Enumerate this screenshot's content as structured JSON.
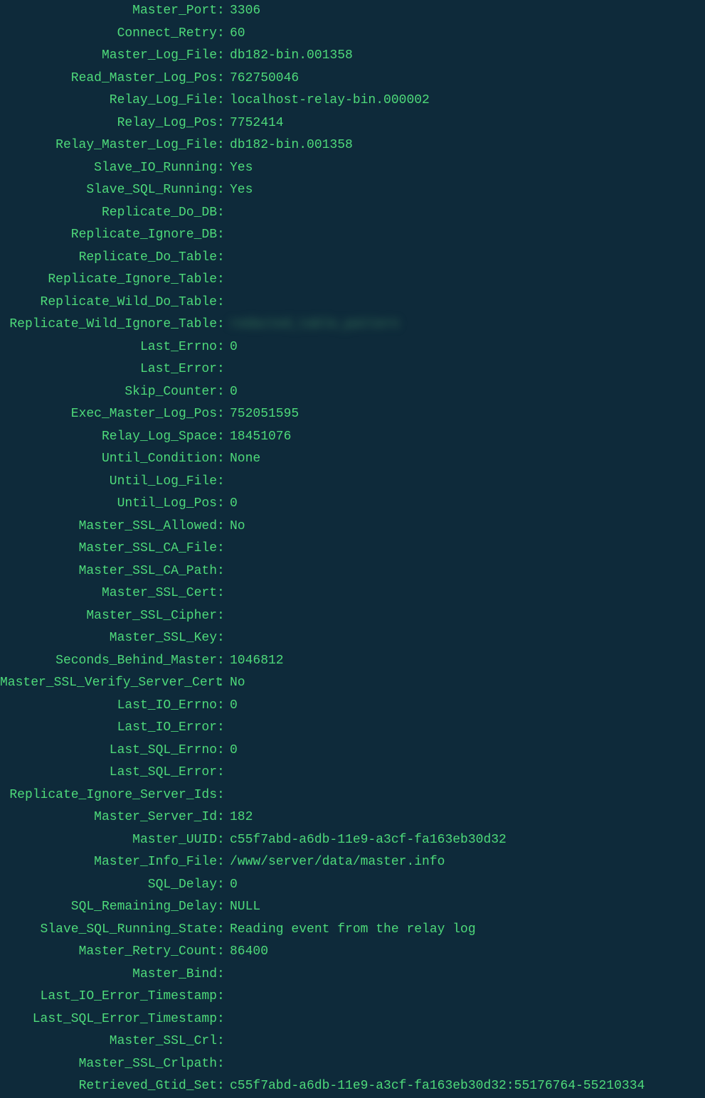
{
  "rows": [
    {
      "label": "Master_Port",
      "value": "3306"
    },
    {
      "label": "Connect_Retry",
      "value": "60"
    },
    {
      "label": "Master_Log_File",
      "value": "db182-bin.001358"
    },
    {
      "label": "Read_Master_Log_Pos",
      "value": "762750046"
    },
    {
      "label": "Relay_Log_File",
      "value": "localhost-relay-bin.000002"
    },
    {
      "label": "Relay_Log_Pos",
      "value": "7752414"
    },
    {
      "label": "Relay_Master_Log_File",
      "value": "db182-bin.001358"
    },
    {
      "label": "Slave_IO_Running",
      "value": "Yes"
    },
    {
      "label": "Slave_SQL_Running",
      "value": "Yes"
    },
    {
      "label": "Replicate_Do_DB",
      "value": ""
    },
    {
      "label": "Replicate_Ignore_DB",
      "value": ""
    },
    {
      "label": "Replicate_Do_Table",
      "value": ""
    },
    {
      "label": "Replicate_Ignore_Table",
      "value": ""
    },
    {
      "label": "Replicate_Wild_Do_Table",
      "value": ""
    },
    {
      "label": "Replicate_Wild_Ignore_Table",
      "value": "redacted_table_pattern",
      "blurred": true
    },
    {
      "label": "Last_Errno",
      "value": "0"
    },
    {
      "label": "Last_Error",
      "value": ""
    },
    {
      "label": "Skip_Counter",
      "value": "0"
    },
    {
      "label": "Exec_Master_Log_Pos",
      "value": "752051595"
    },
    {
      "label": "Relay_Log_Space",
      "value": "18451076"
    },
    {
      "label": "Until_Condition",
      "value": "None"
    },
    {
      "label": "Until_Log_File",
      "value": ""
    },
    {
      "label": "Until_Log_Pos",
      "value": "0"
    },
    {
      "label": "Master_SSL_Allowed",
      "value": "No"
    },
    {
      "label": "Master_SSL_CA_File",
      "value": ""
    },
    {
      "label": "Master_SSL_CA_Path",
      "value": ""
    },
    {
      "label": "Master_SSL_Cert",
      "value": ""
    },
    {
      "label": "Master_SSL_Cipher",
      "value": ""
    },
    {
      "label": "Master_SSL_Key",
      "value": ""
    },
    {
      "label": "Seconds_Behind_Master",
      "value": "1046812"
    },
    {
      "label": "Master_SSL_Verify_Server_Cert",
      "value": "No"
    },
    {
      "label": "Last_IO_Errno",
      "value": "0"
    },
    {
      "label": "Last_IO_Error",
      "value": ""
    },
    {
      "label": "Last_SQL_Errno",
      "value": "0"
    },
    {
      "label": "Last_SQL_Error",
      "value": ""
    },
    {
      "label": "Replicate_Ignore_Server_Ids",
      "value": ""
    },
    {
      "label": "Master_Server_Id",
      "value": "182"
    },
    {
      "label": "Master_UUID",
      "value": "c55f7abd-a6db-11e9-a3cf-fa163eb30d32"
    },
    {
      "label": "Master_Info_File",
      "value": "/www/server/data/master.info"
    },
    {
      "label": "SQL_Delay",
      "value": "0"
    },
    {
      "label": "SQL_Remaining_Delay",
      "value": "NULL"
    },
    {
      "label": "Slave_SQL_Running_State",
      "value": "Reading event from the relay log"
    },
    {
      "label": "Master_Retry_Count",
      "value": "86400"
    },
    {
      "label": "Master_Bind",
      "value": ""
    },
    {
      "label": "Last_IO_Error_Timestamp",
      "value": ""
    },
    {
      "label": "Last_SQL_Error_Timestamp",
      "value": ""
    },
    {
      "label": "Master_SSL_Crl",
      "value": ""
    },
    {
      "label": "Master_SSL_Crlpath",
      "value": ""
    },
    {
      "label": "Retrieved_Gtid_Set",
      "value": "c55f7abd-a6db-11e9-a3cf-fa163eb30d32:55176764-55210334"
    }
  ],
  "separator": ": "
}
